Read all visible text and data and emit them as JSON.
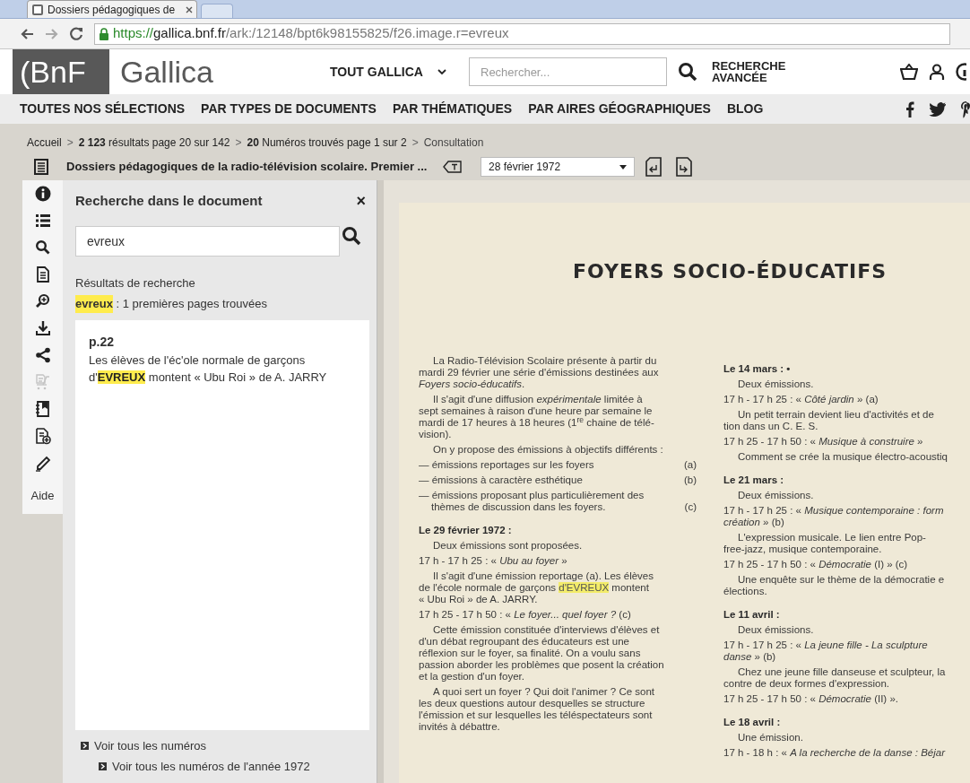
{
  "browser": {
    "tab_title": "Dossiers pédagogiques de",
    "url_parts": [
      "https://",
      "gallica.bnf.fr",
      "/ark:/12148/bpt6k98155825/f26.image.r=evreux"
    ]
  },
  "header": {
    "logo": "(BnF",
    "site_name": "Gallica",
    "scope": "TOUT GALLICA",
    "search_placeholder": "Rechercher...",
    "advanced_search": "RECHERCHE AVANCÉE"
  },
  "nav": [
    "TOUTES NOS SÉLECTIONS",
    "PAR TYPES DE DOCUMENTS",
    "PAR THÉMATIQUES",
    "PAR AIRES GÉOGRAPHIQUES",
    "BLOG"
  ],
  "breadcrumb": [
    {
      "kind": "link",
      "text": "Accueil"
    },
    {
      "kind": "separator",
      "text": ">"
    },
    {
      "kind": "link",
      "text": "**2 123** résultats page 20 sur 142"
    },
    {
      "kind": "separator",
      "text": ">"
    },
    {
      "kind": "link",
      "text": "**20** Numéros trouvés page 1 sur 2"
    },
    {
      "kind": "separator",
      "text": ">"
    },
    {
      "kind": "current",
      "text": "Consultation"
    }
  ],
  "document_title": "Dossiers pédagogiques de la radio-télévision scolaire. Premier ...",
  "date_select": "28 février 1972",
  "side_tools": [
    {
      "disabled": false
    },
    {
      "disabled": false
    },
    {
      "disabled": false
    },
    {
      "disabled": false
    },
    {
      "disabled": false
    },
    {
      "disabled": false
    },
    {
      "disabled": false
    },
    {
      "disabled": true
    },
    {
      "disabled": false
    },
    {
      "disabled": false
    },
    {
      "disabled": false
    }
  ],
  "help_label": "Aide",
  "search_panel": {
    "title": "Recherche dans le document",
    "close": "×",
    "query": "evreux",
    "results_heading": "Résultats de recherche",
    "summary_term": "evreux",
    "summary_text": " : 1 premières pages trouvées",
    "results": [
      {
        "page": "p.22",
        "before": "Les élèves de l'éc'ole normale de garçons d'",
        "match": "EVREUX",
        "after": " montent « Ubu Roi » de A. JARRY"
      }
    ]
  },
  "bottom_links": [
    "Voir tous les numéros",
    "Voir tous les numéros de l'année 1972"
  ],
  "scan": {
    "heading": "FOYERS SOCIO-ÉDUCATIFS",
    "column_1": [
      {
        "kind": "para",
        "lines": [
          "La Radio-Télévision Scolaire présente à partir du",
          "mardi 29 février une série d'émissions destinées aux",
          "*Foyers socio-éducatifs*."
        ]
      },
      {
        "kind": "para",
        "lines": [
          "Il s'agit d'une diffusion *expérimentale* limitée à",
          "sept semaines à raison d'une heure par semaine le",
          "mardi de 17 heures à 18 heures (1$^{re}$ chaine de télé-",
          "vision)."
        ]
      },
      {
        "kind": "para",
        "lines": [
          "On y propose des émissions à objectifs différents :"
        ]
      },
      {
        "kind": "item",
        "lines": [
          "— émissions reportages sur les foyers"
        ],
        "tag": "(a)"
      },
      {
        "kind": "item",
        "lines": [
          "— émissions à caractère esthétique"
        ],
        "tag": "(b)"
      },
      {
        "kind": "item",
        "lines": [
          "— émissions proposant plus particulièrement des",
          "thèmes de discussion dans les foyers."
        ],
        "tag": "(c)"
      },
      {
        "kind": "heading",
        "lines": [
          "Le 29 février 1972 :"
        ]
      },
      {
        "kind": "para",
        "lines": [
          "Deux émissions sont proposées."
        ]
      },
      {
        "kind": "time",
        "lines": [
          "17 h - 17 h 25 : « *Ubu au foyer* »"
        ]
      },
      {
        "kind": "para",
        "lines": [
          "Il s'agit d'une émission reportage (a). Les élèves",
          {
            "before": "de l'école normale de garçons ",
            "match": "d'EVREUX",
            "after": " montent"
          },
          "« Ubu Roi » de A. JARRY."
        ]
      },
      {
        "kind": "time",
        "lines": [
          "17 h 25 - 17 h 50 : « *Le foyer... quel foyer ?* (c)"
        ]
      },
      {
        "kind": "para",
        "lines": [
          "Cette émission constituée d'interviews d'élèves et",
          "d'un débat regroupant des éducateurs est une",
          "réflexion sur le foyer, sa finalité. On a voulu sans",
          "passion aborder les problèmes que posent la création",
          "et la gestion d'un foyer."
        ]
      },
      {
        "kind": "para",
        "lines": [
          "A quoi sert un foyer ? Qui doit l'animer ? Ce sont",
          "les deux questions autour desquelles se structure",
          "l'émission et sur lesquelles les téléspectateurs sont",
          "invités à débattre."
        ]
      }
    ],
    "column_2": [
      {
        "kind": "heading",
        "lines": [
          "Le 14 mars : •"
        ]
      },
      {
        "kind": "para",
        "lines": [
          "Deux émissions."
        ]
      },
      {
        "kind": "time",
        "lines": [
          "17 h - 17 h 25 : « *Côté jardin* » (a)"
        ]
      },
      {
        "kind": "para",
        "lines": [
          "Un petit terrain devient lieu d'activités et de",
          "tion dans un C. E. S."
        ]
      },
      {
        "kind": "time",
        "lines": [
          "17 h 25 - 17 h 50 : « *Musique à construire* »"
        ]
      },
      {
        "kind": "para",
        "lines": [
          "Comment se crée la musique électro-acoustiq"
        ]
      },
      {
        "kind": "heading",
        "lines": [
          "Le 21 mars :"
        ]
      },
      {
        "kind": "para",
        "lines": [
          "Deux émissions."
        ]
      },
      {
        "kind": "time",
        "lines": [
          "17 h - 17 h 25 : « *Musique contemporaine : form*",
          "*création* » (b)"
        ]
      },
      {
        "kind": "para",
        "lines": [
          "L'expression musicale. Le lien entre Pop-",
          "free-jazz, musique contemporaine."
        ]
      },
      {
        "kind": "time",
        "lines": [
          "17 h 25 - 17 h 50 : « *Démocratie* (I) » (c)"
        ]
      },
      {
        "kind": "para",
        "lines": [
          "Une enquête sur le thème de la démocratie e",
          "élections."
        ]
      },
      {
        "kind": "heading",
        "lines": [
          "Le 11 avril :"
        ]
      },
      {
        "kind": "para",
        "lines": [
          "Deux émissions."
        ]
      },
      {
        "kind": "time",
        "lines": [
          "17 h - 17 h 25 : « *La jeune fille - La sculpture*",
          "*danse* » (b)"
        ]
      },
      {
        "kind": "para",
        "lines": [
          "Chez une jeune fille danseuse et sculpteur, la",
          "contre de deux formes d'expression."
        ]
      },
      {
        "kind": "time",
        "lines": [
          "17 h 25 - 17 h 50 : « *Démocratie* (II) »."
        ]
      },
      {
        "kind": "heading",
        "lines": [
          "Le 18 avril :"
        ]
      },
      {
        "kind": "para",
        "lines": [
          "Une émission."
        ]
      },
      {
        "kind": "time",
        "lines": [
          "17 h - 18 h : « *A la recherche de la danse : Béjar*"
        ]
      }
    ]
  }
}
